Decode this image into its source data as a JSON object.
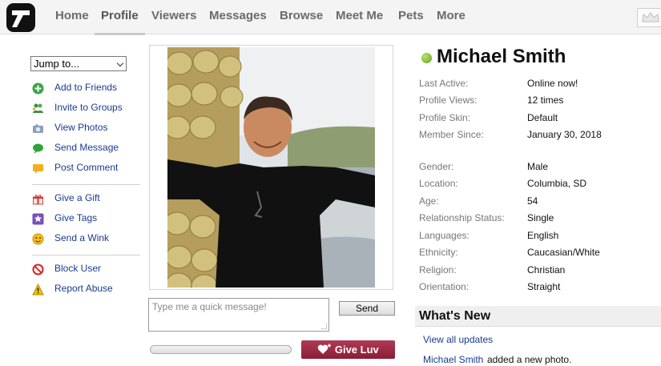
{
  "nav": {
    "items": [
      "Home",
      "Profile",
      "Viewers",
      "Messages",
      "Browse",
      "Meet Me",
      "Pets",
      "More"
    ],
    "active": "Profile"
  },
  "sidebar": {
    "jump_label": "Jump to...",
    "items": [
      {
        "label": "Add to Friends",
        "icon": "add-friend-icon"
      },
      {
        "label": "Invite to Groups",
        "icon": "groups-icon"
      },
      {
        "label": "View Photos",
        "icon": "camera-icon"
      },
      {
        "label": "Send Message",
        "icon": "chat-bubble-icon"
      },
      {
        "label": "Post Comment",
        "icon": "comment-icon"
      },
      {
        "label": "Give a Gift",
        "icon": "gift-icon"
      },
      {
        "label": "Give Tags",
        "icon": "star-tag-icon"
      },
      {
        "label": "Send a Wink",
        "icon": "wink-icon"
      },
      {
        "label": "Block User",
        "icon": "block-icon"
      },
      {
        "label": "Report Abuse",
        "icon": "warning-icon"
      }
    ]
  },
  "composer": {
    "placeholder": "Type me a quick message!",
    "send_label": "Send",
    "give_luv_label": "Give Luv"
  },
  "profile": {
    "name": "Michael Smith",
    "status_color": "#6cb32a",
    "activity": [
      {
        "k": "Last Active:",
        "v": "Online now!"
      },
      {
        "k": "Profile Views:",
        "v": "12 times"
      },
      {
        "k": "Profile Skin:",
        "v": "Default"
      },
      {
        "k": "Member Since:",
        "v": "January 30, 2018"
      }
    ],
    "details": [
      {
        "k": "Gender:",
        "v": "Male"
      },
      {
        "k": "Location:",
        "v": "Columbia, SD"
      },
      {
        "k": "Age:",
        "v": "54"
      },
      {
        "k": "Relationship Status:",
        "v": "Single"
      },
      {
        "k": "Languages:",
        "v": "English"
      },
      {
        "k": "Ethnicity:",
        "v": "Caucasian/White"
      },
      {
        "k": "Religion:",
        "v": "Christian"
      },
      {
        "k": "Orientation:",
        "v": "Straight"
      }
    ]
  },
  "whats_new": {
    "title": "What's New",
    "view_all": "View all updates",
    "update_user": "Michael Smith",
    "update_text": "added a new photo."
  }
}
